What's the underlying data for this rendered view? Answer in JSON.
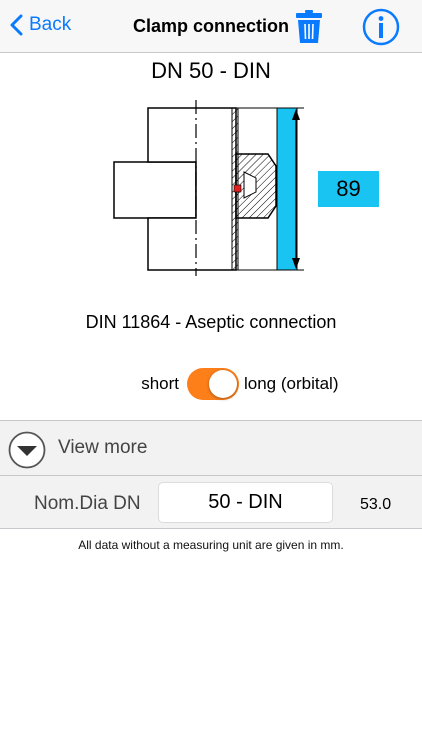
{
  "nav": {
    "back_label": "Back",
    "title": "Clamp connection"
  },
  "heading": "DN 50 - DIN",
  "drawing": {
    "dimension_value": "89",
    "colors": {
      "dimension_bar": "#19c4f2",
      "seal_marker": "#e02020"
    }
  },
  "connection_name": "DIN 11864 - Aseptic connection",
  "toggle": {
    "left_label": "short",
    "right_label": "long (orbital)",
    "state": "on",
    "on_color": "#fd7f1a"
  },
  "view_more": {
    "label": "View more"
  },
  "nominal": {
    "label": "Nom.Dia DN",
    "value": "50 - DIN",
    "extra": "53.0"
  },
  "footnote": "All data without a measuring unit are given in mm.",
  "colors": {
    "accent": "#0a7aff",
    "background_gray": "#f2f2f2"
  }
}
